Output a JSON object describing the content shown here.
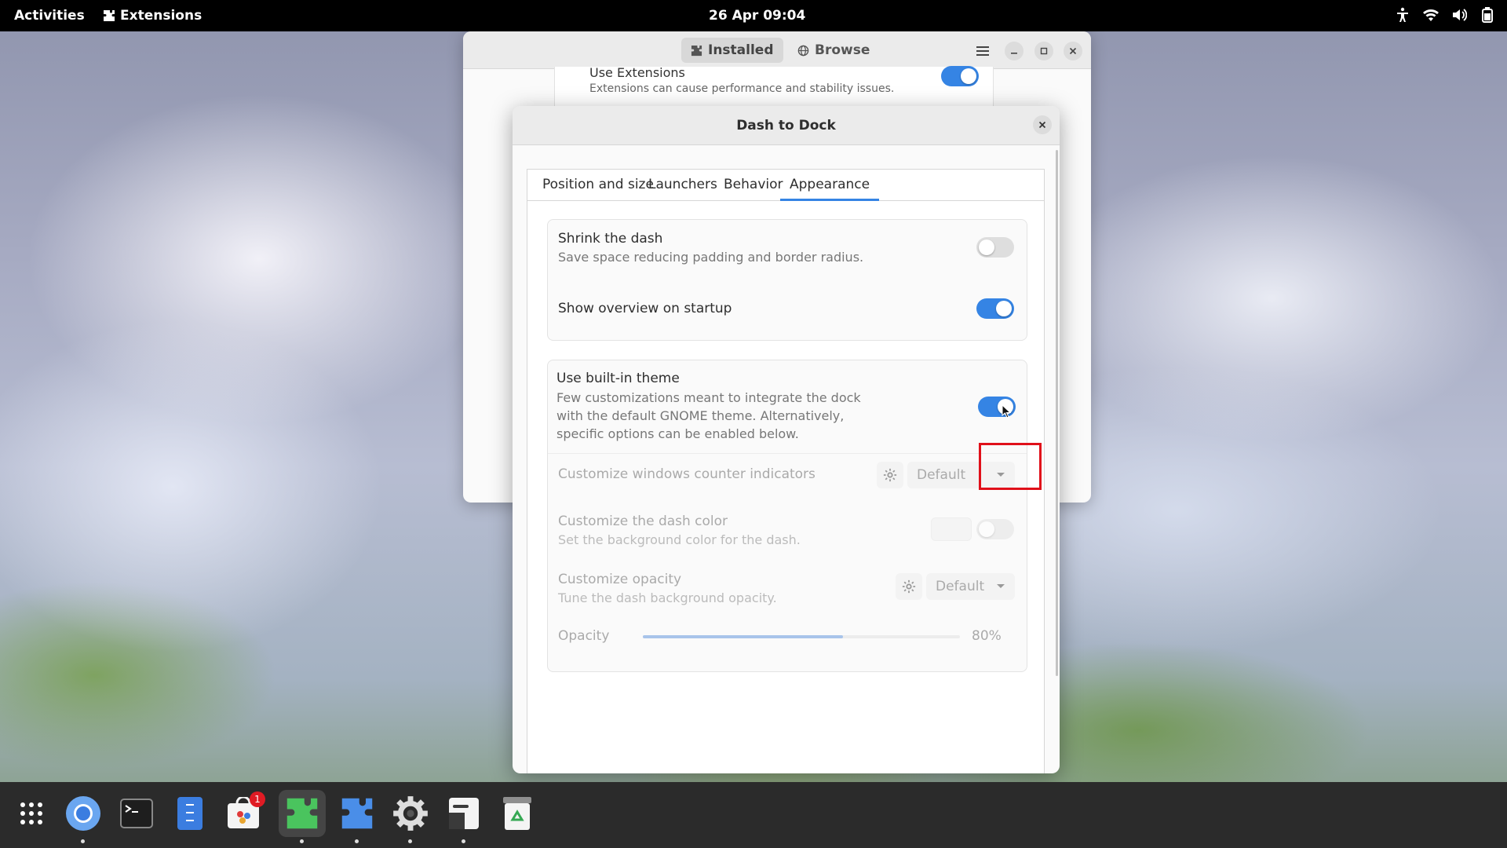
{
  "topbar": {
    "activities": "Activities",
    "app_name": "Extensions",
    "clock": "26 Apr  09:04",
    "icons": [
      "accessibility-icon",
      "wifi-icon",
      "volume-icon",
      "battery-icon"
    ]
  },
  "extensions_window": {
    "tabs": [
      {
        "label": "Installed",
        "icon": "puzzle-icon",
        "active": true
      },
      {
        "label": "Browse",
        "icon": "globe-icon",
        "active": false
      }
    ],
    "use_extensions": {
      "title": "Use Extensions",
      "subtitle": "Extensions can cause performance and stability issues.",
      "enabled": true
    }
  },
  "dialog": {
    "title": "Dash to Dock",
    "tabs": [
      "Position and size",
      "Launchers",
      "Behavior",
      "Appearance"
    ],
    "active_tab": "Appearance",
    "group1": {
      "shrink": {
        "title": "Shrink the dash",
        "subtitle": "Save space reducing padding and border radius.",
        "enabled": false
      },
      "overview": {
        "title": "Show overview on startup",
        "enabled": true
      }
    },
    "group2": {
      "builtin_theme": {
        "title": "Use built-in theme",
        "subtitle_lines": [
          "Few customizations meant to integrate the dock",
          "with the default GNOME theme. Alternatively,",
          "specific options can be enabled below."
        ],
        "enabled": true
      },
      "counter": {
        "title": "Customize windows counter indicators",
        "value": "Default"
      },
      "dash_color": {
        "title": "Customize the dash color",
        "subtitle": "Set the background color for the dash.",
        "enabled": false
      },
      "opacity_mode": {
        "title": "Customize opacity",
        "subtitle": "Tune the dash background opacity.",
        "value": "Default"
      },
      "opacity": {
        "label": "Opacity",
        "value_text": "80%",
        "fraction": 0.8
      }
    }
  },
  "dock": {
    "items": [
      {
        "name": "app-grid-icon",
        "running": false
      },
      {
        "name": "chromium-icon",
        "running": true
      },
      {
        "name": "terminal-icon",
        "running": false
      },
      {
        "name": "text-editor-icon",
        "running": false
      },
      {
        "name": "software-icon",
        "running": false,
        "badge": "1"
      },
      {
        "name": "extensions-icon",
        "running": true
      },
      {
        "name": "extension-manager-icon",
        "running": true
      },
      {
        "name": "settings-icon",
        "running": true
      },
      {
        "name": "sticky-notes-icon",
        "running": true
      },
      {
        "name": "trash-icon",
        "running": false
      }
    ]
  },
  "colors": {
    "accent": "#3584e4",
    "highlight": "#e0101a"
  }
}
